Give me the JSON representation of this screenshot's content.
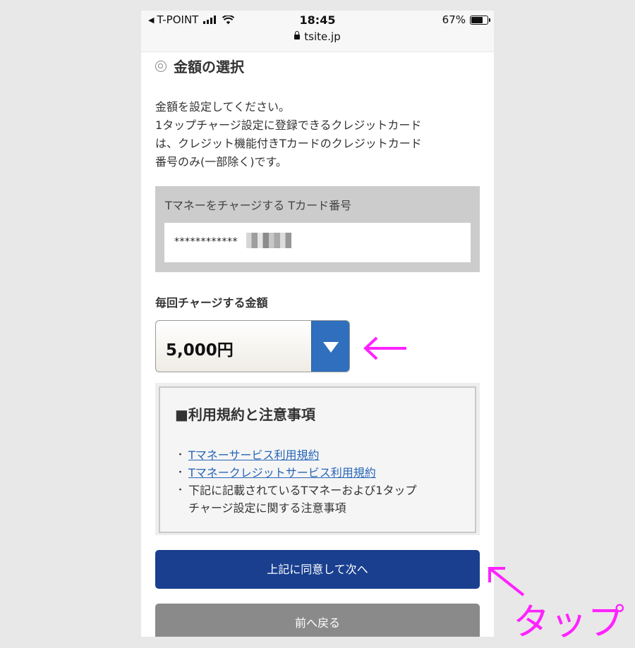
{
  "status_bar": {
    "carrier": "T-POINT",
    "time": "18:45",
    "battery_percent": "67%",
    "battery_level": 0.67,
    "url": "tsite.jp"
  },
  "section": {
    "title": "金額の選択"
  },
  "intro_lines": [
    "金額を設定してください。",
    "1タップチャージ設定に登録できるクレジットカード",
    "は、クレジット機能付きTカードのクレジットカード",
    "番号のみ(一部除く)です。"
  ],
  "card": {
    "label": "Tマネーをチャージする Tカード番号",
    "masked_number": "************"
  },
  "amount": {
    "label": "毎回チャージする金額",
    "selected_value": "5,000円"
  },
  "terms": {
    "title": "■利用規約と注意事項",
    "link1": "Tマネーサービス利用規約",
    "link2": "Tマネークレジットサービス利用規約",
    "note_line1": "下記に記載されているTマネーおよび1タップ",
    "note_line2": "チャージ設定に関する注意事項"
  },
  "buttons": {
    "next": "上記に同意して次へ",
    "back": "前へ戻る"
  },
  "annotation": {
    "tap_text": "タップ",
    "color": "#ff22ff"
  }
}
